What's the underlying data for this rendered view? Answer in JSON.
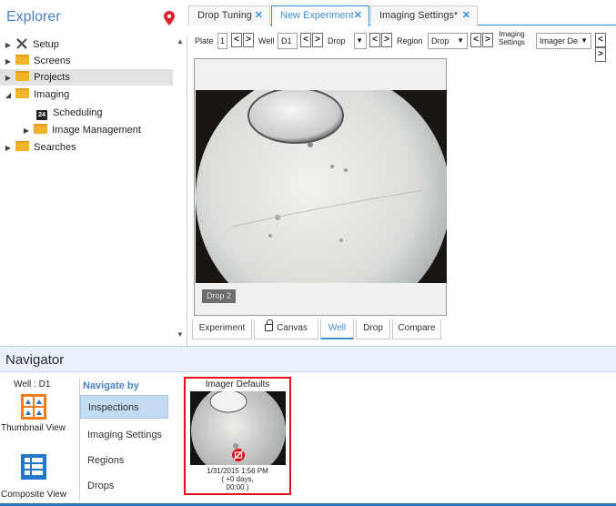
{
  "explorer": {
    "title": "Explorer",
    "items": [
      {
        "label": "Setup",
        "icon": "wrench-screwdriver-icon",
        "expanded": false
      },
      {
        "label": "Screens",
        "icon": "folder-icon",
        "expanded": false
      },
      {
        "label": "Projects",
        "icon": "folder-icon",
        "expanded": false,
        "selected": true
      },
      {
        "label": "Imaging",
        "icon": "folder-icon",
        "expanded": true
      },
      {
        "label": "Scheduling",
        "icon": "calendar-icon"
      },
      {
        "label": "Image Management",
        "icon": "folder-icon",
        "expanded": false
      },
      {
        "label": "Searches",
        "icon": "folder-icon",
        "expanded": false
      }
    ],
    "calendar_icon_text": "24"
  },
  "tabs": [
    {
      "label": "Drop Tuning",
      "active": false
    },
    {
      "label": "New Experiment",
      "active": true
    },
    {
      "label": "Imaging Settings*",
      "active": false
    }
  ],
  "toolbar": {
    "plate_label": "Plate",
    "plate_value": "1",
    "well_label": "Well",
    "well_value": "D1",
    "drop_label": "Drop",
    "region_label": "Region",
    "region_value": "Drop",
    "imaging_settings_label_line1": "Imaging",
    "imaging_settings_label_line2": "Settings",
    "imaging_settings_value": "Imager De",
    "prev_symbol": "<",
    "next_symbol": ">"
  },
  "viewer": {
    "drop_badge": "Drop 2"
  },
  "view_tabs": [
    {
      "label": "Experiment",
      "active": false
    },
    {
      "label": "Canvas",
      "active": false,
      "icon": "lock-icon"
    },
    {
      "label": "Well",
      "active": true
    },
    {
      "label": "Drop",
      "active": false
    },
    {
      "label": "Compare",
      "active": false
    }
  ],
  "navigator": {
    "title": "Navigator",
    "well_label": "Well : D1",
    "thumbnail_view_label": "Thumbnail View",
    "composite_view_label": "Composite View",
    "navigate_by_title": "Navigate by",
    "navigate_by_items": [
      {
        "label": "Inspections",
        "active": true
      },
      {
        "label": "Imaging Settings",
        "active": false
      },
      {
        "label": "Regions",
        "active": false
      },
      {
        "label": "Drops",
        "active": false
      }
    ],
    "thumbnail": {
      "title": "Imager Defaults",
      "date": "1/31/2015 1:56 PM",
      "offset_line1": "( +0 days,",
      "offset_line2": "00:00 )"
    }
  },
  "colors": {
    "accent": "#3b8fd6",
    "folder": "#f1b22c",
    "selection_highlight": "#e0101a",
    "navigator_header": "#e9f1fa"
  }
}
